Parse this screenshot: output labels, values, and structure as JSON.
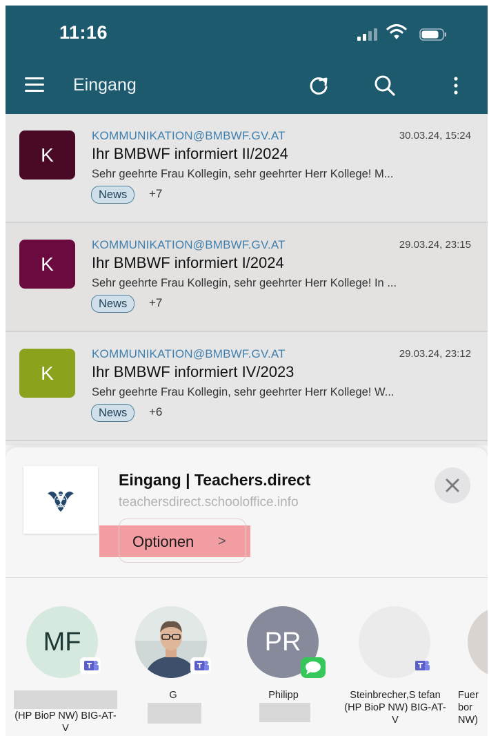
{
  "status_bar": {
    "time": "11:16"
  },
  "app_bar": {
    "title": "Eingang"
  },
  "mails": [
    {
      "avatar_letter": "K",
      "avatar_color": "#4a0a26",
      "sender": "KOMMUNIKATION@BMBWF.GV.AT",
      "date": "30.03.24, 15:24",
      "subject": "Ihr BMBWF informiert II/2024",
      "preview": "Sehr geehrte Frau Kollegin, sehr geehrter Herr Kollege! M...",
      "tag": "News",
      "more": "+7"
    },
    {
      "avatar_letter": "K",
      "avatar_color": "#6a0a3e",
      "sender": "KOMMUNIKATION@BMBWF.GV.AT",
      "date": "29.03.24, 23:15",
      "subject": "Ihr BMBWF informiert I/2024",
      "preview": "Sehr geehrte Frau Kollegin, sehr geehrter Herr Kollege! In ...",
      "tag": "News",
      "more": "+7"
    },
    {
      "avatar_letter": "K",
      "avatar_color": "#8aa21c",
      "sender": "KOMMUNIKATION@BMBWF.GV.AT",
      "date": "29.03.24, 23:12",
      "subject": "Ihr BMBWF informiert IV/2023",
      "preview": "Sehr geehrte Frau Kollegin, sehr geehrter Herr Kollege! W...",
      "tag": "News",
      "more": "+6"
    }
  ],
  "share_sheet": {
    "title": "Eingang | Teachers.direct",
    "url": "teachersdirect.schooloffice.info",
    "options_label": "Optionen",
    "options_chevron": ">",
    "close_glyph": "✕",
    "contacts": [
      {
        "initials": "MF",
        "name": "(HP BioP NW) BIG-AT-V",
        "badge": "teams-icon"
      },
      {
        "initials": "",
        "name": "G",
        "badge": "teams-icon"
      },
      {
        "initials": "PR",
        "name": "Philipp",
        "badge": "messages-icon"
      },
      {
        "initials": "",
        "name": "Steinbrecher,S tefan (HP BioP NW) BIG-AT-V",
        "badge": "teams-icon"
      },
      {
        "initials": "",
        "name": "Fuer bor NW)",
        "badge": ""
      }
    ]
  }
}
